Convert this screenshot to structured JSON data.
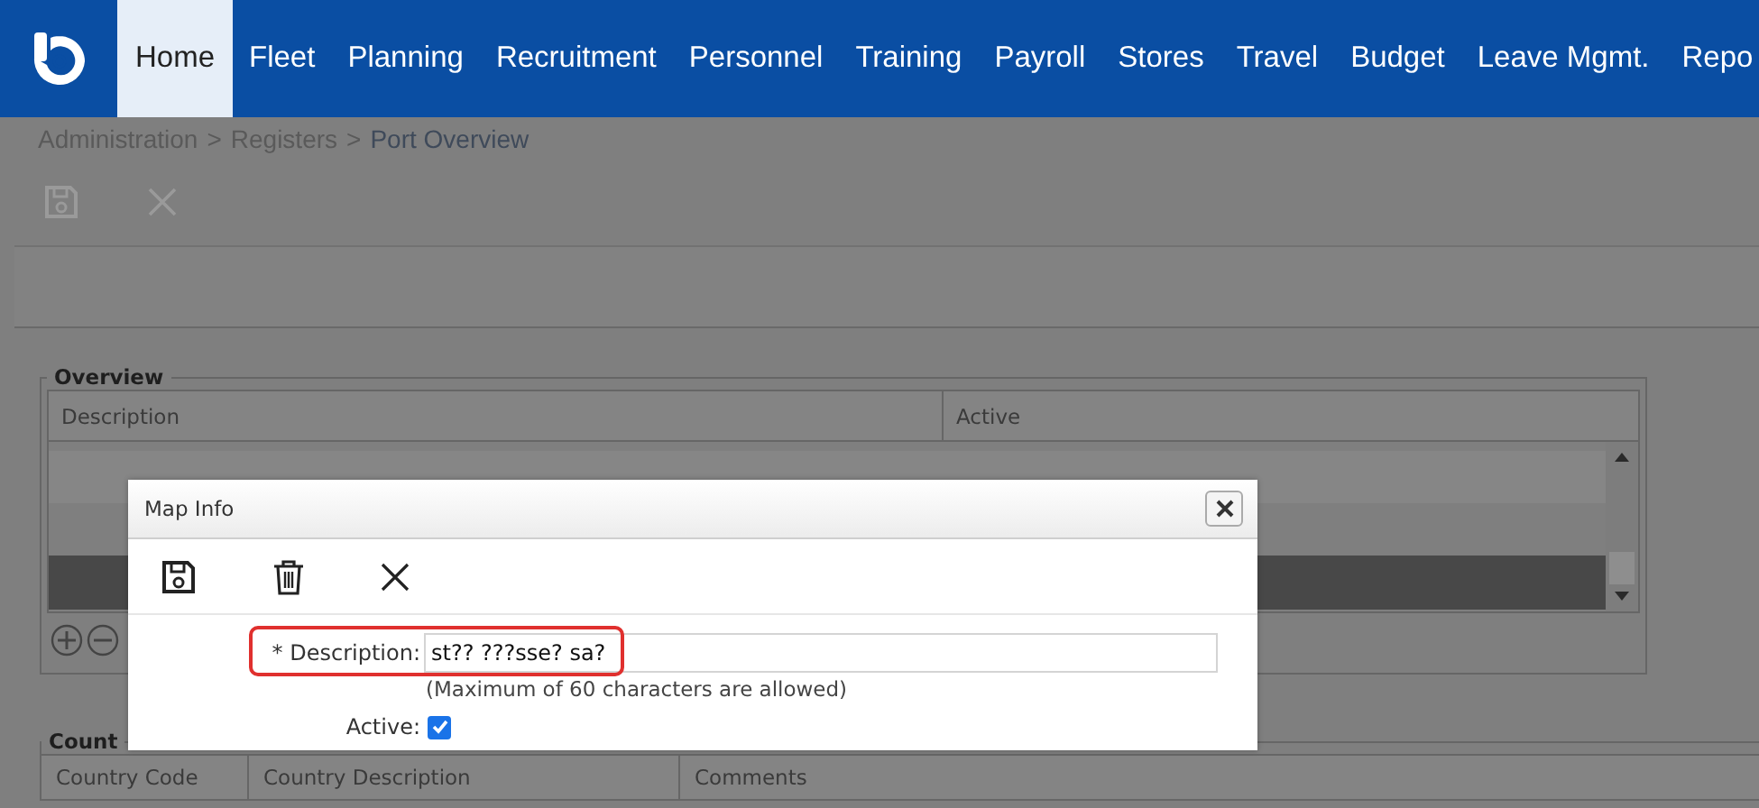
{
  "nav": {
    "items": [
      {
        "label": "Home",
        "selected": true
      },
      {
        "label": "Fleet",
        "selected": false
      },
      {
        "label": "Planning",
        "selected": false
      },
      {
        "label": "Recruitment",
        "selected": false
      },
      {
        "label": "Personnel",
        "selected": false
      },
      {
        "label": "Training",
        "selected": false
      },
      {
        "label": "Payroll",
        "selected": false
      },
      {
        "label": "Stores",
        "selected": false
      },
      {
        "label": "Travel",
        "selected": false
      },
      {
        "label": "Budget",
        "selected": false
      },
      {
        "label": "Leave Mgmt.",
        "selected": false
      },
      {
        "label": "Repo",
        "selected": false
      }
    ]
  },
  "breadcrumb": [
    "Administration",
    ">",
    "Registers",
    ">",
    "Port Overview"
  ],
  "overview": {
    "title": "Overview",
    "columns": [
      "Description",
      "Active"
    ],
    "rows": [
      {
        "selected": false
      },
      {
        "selected": false
      },
      {
        "selected": true
      }
    ]
  },
  "country": {
    "title": "Count",
    "columns": [
      "Country Code",
      "Country Description",
      "Comments"
    ]
  },
  "dialog": {
    "title": "Map Info",
    "description": {
      "label": "* Description:",
      "value": "st?? ???sse? sa?",
      "hint": "(Maximum of 60 characters are allowed)",
      "highlighted": true
    },
    "active": {
      "label": "Active:",
      "checked": true
    }
  }
}
